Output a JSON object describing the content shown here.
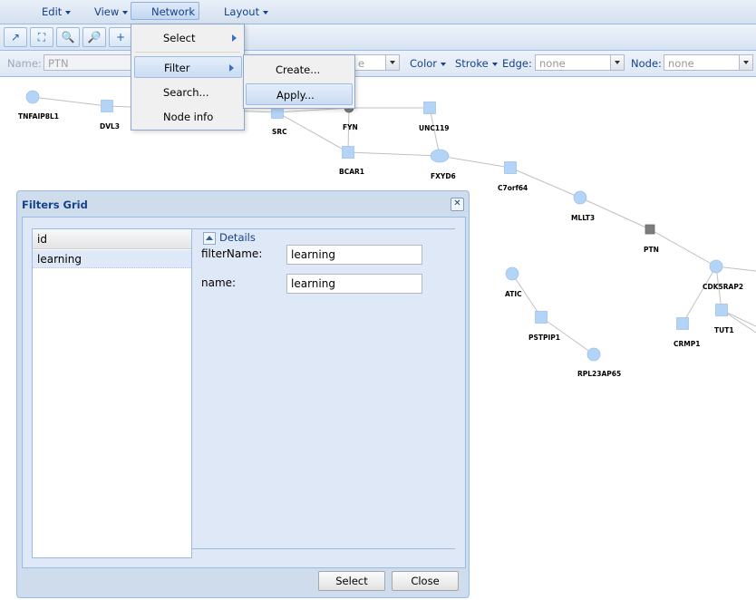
{
  "menubar": {
    "edit": "Edit",
    "view": "View",
    "network": "Network",
    "layout": "Layout"
  },
  "toolbar": {
    "icons": [
      "arrow-icon",
      "fit-icon",
      "zoom-in-icon",
      "zoom-out-icon",
      "add-icon"
    ]
  },
  "filterbar": {
    "name_label": "Name:",
    "name_value": "PTN",
    "shape_value": "e",
    "color_label": "Color",
    "stroke_label": "Stroke",
    "edge_label": "Edge:",
    "edge_value": "none",
    "node_label": "Node:",
    "node_value": "none"
  },
  "network_menu": {
    "items": [
      {
        "label": "Select"
      },
      {
        "label": "Filter"
      },
      {
        "label": "Search..."
      },
      {
        "label": "Node info"
      }
    ]
  },
  "filter_submenu": {
    "items": [
      {
        "label": "Create..."
      },
      {
        "label": "Apply..."
      }
    ]
  },
  "graph": {
    "node_fill": "#b3d4f7",
    "gray_fill": "#7d7d7d",
    "edge_color": "#c0c0c0",
    "nodes": [
      {
        "id": "TNFAIP8L1",
        "label": "TNFAIP8L1"
      },
      {
        "id": "DVL3",
        "label": "DVL3"
      },
      {
        "id": "SRC",
        "label": "SRC"
      },
      {
        "id": "FYN",
        "label": "FYN"
      },
      {
        "id": "UNC119",
        "label": "UNC119"
      },
      {
        "id": "BCAR1",
        "label": "BCAR1"
      },
      {
        "id": "FXYD6",
        "label": "FXYD6"
      },
      {
        "id": "C7orf64",
        "label": "C7orf64"
      },
      {
        "id": "MLLT3",
        "label": "MLLT3"
      },
      {
        "id": "PTN",
        "label": "PTN"
      },
      {
        "id": "CDK5RAP2",
        "label": "CDK5RAP2"
      },
      {
        "id": "TUT1",
        "label": "TUT1"
      },
      {
        "id": "CRMP1",
        "label": "CRMP1"
      },
      {
        "id": "ATIC",
        "label": "ATIC"
      },
      {
        "id": "PSTPIP1",
        "label": "PSTPIP1"
      },
      {
        "id": "RPL23AP65",
        "label": "RPL23AP65"
      }
    ]
  },
  "filters_window": {
    "title": "Filters Grid",
    "grid": {
      "column_header": "id",
      "rows": [
        "learning"
      ]
    },
    "details": {
      "legend": "Details",
      "filter_name_label": "filterName:",
      "filter_name_value": "learning",
      "name_label": "name:",
      "name_value": "learning"
    },
    "select_button": "Select",
    "close_button": "Close"
  }
}
